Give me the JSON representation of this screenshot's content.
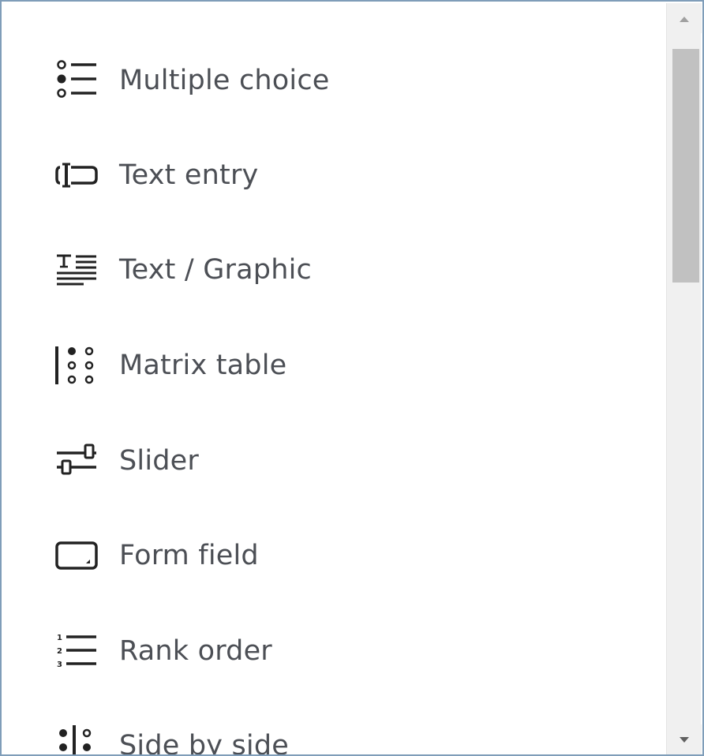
{
  "menu": {
    "items": [
      {
        "label": "Multiple choice",
        "icon": "multiple-choice-icon"
      },
      {
        "label": "Text entry",
        "icon": "text-entry-icon"
      },
      {
        "label": "Text / Graphic",
        "icon": "text-graphic-icon"
      },
      {
        "label": "Matrix table",
        "icon": "matrix-table-icon"
      },
      {
        "label": "Slider",
        "icon": "slider-icon"
      },
      {
        "label": "Form field",
        "icon": "form-field-icon"
      },
      {
        "label": "Rank order",
        "icon": "rank-order-icon"
      },
      {
        "label": "Side by side",
        "icon": "side-by-side-icon"
      }
    ]
  },
  "scrollbar": {
    "up_icon": "scroll-up-arrow-icon",
    "down_icon": "scroll-down-arrow-icon",
    "position": 0
  },
  "colors": {
    "label_text": "#4c4f55",
    "icon": "#222222",
    "border": "#7f9db9",
    "scroll_track": "#f0f0f0",
    "scroll_thumb": "#c1c1c1"
  }
}
